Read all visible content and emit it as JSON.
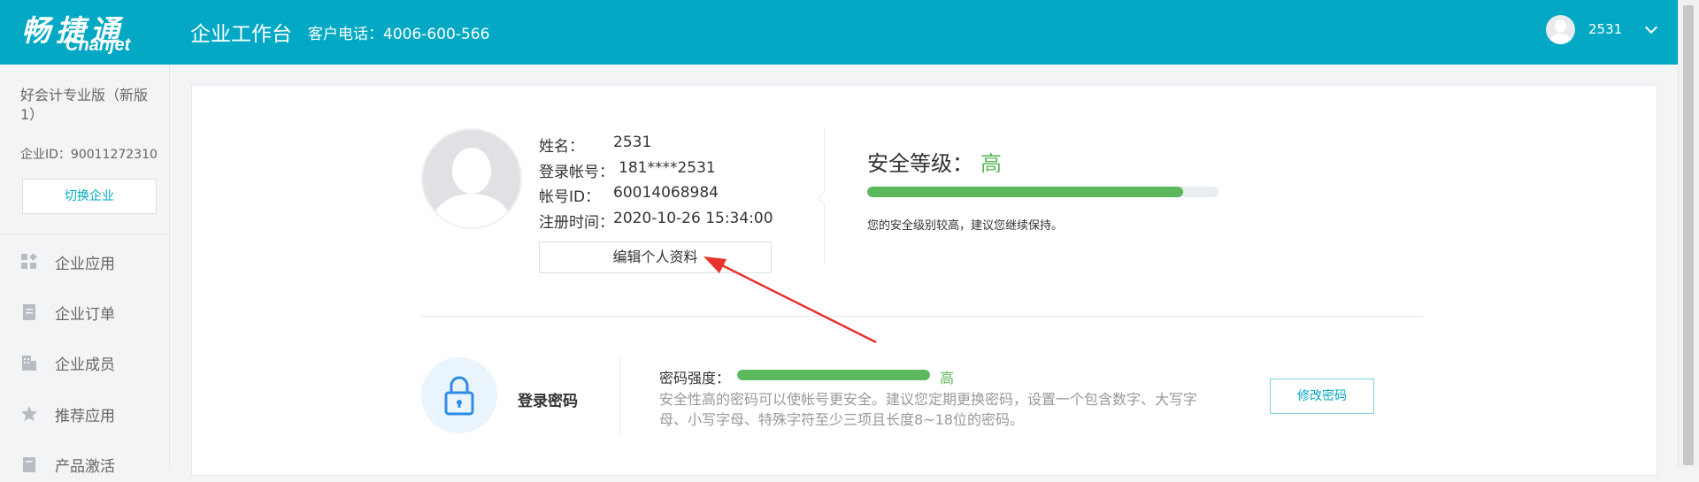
{
  "header": {
    "logo_cn": "畅捷通",
    "logo_en": "Chanjet",
    "app_title": "企业工作台",
    "phone": "客户电话：4006-600-566",
    "user_name": "2531",
    "user_menu_icon": "chevron-down-icon"
  },
  "sidebar": {
    "company_name": "好会计专业版（新版1）",
    "company_id": "企业ID：90011272310",
    "switch_label": "切换企业",
    "items": [
      {
        "label": "企业应用",
        "icon": "apps-icon"
      },
      {
        "label": "企业订单",
        "icon": "order-icon"
      },
      {
        "label": "企业成员",
        "icon": "building-icon"
      },
      {
        "label": "推荐应用",
        "icon": "star-icon"
      },
      {
        "label": "产品激活",
        "icon": "activate-icon"
      }
    ]
  },
  "profile": {
    "name_label": "姓名：",
    "name_value": "2531",
    "account_label": "登录帐号：",
    "account_value": "181****2531",
    "id_label": "帐号ID：",
    "id_value": "60014068984",
    "reg_label": "注册时间：",
    "reg_value": "2020-10-26 15:34:00",
    "edit_label": "编辑个人资料"
  },
  "security": {
    "title": "安全等级：",
    "level": "高",
    "level_fraction": 0.9,
    "tip": "您的安全级别较高，建议您继续保持。"
  },
  "password": {
    "label": "登录密码",
    "strength_label": "密码强度：",
    "strength_level": "高",
    "strength_fraction": 1.0,
    "desc_line1": "安全性高的密码可以使帐号更安全。建议您定期更换密码，设置一个包含数字、大写字",
    "desc_line2": "母、小写字母、特殊字符至少三项且长度8~18位的密码。",
    "change_label": "修改密码"
  },
  "colors": {
    "brand": "#03a9c4",
    "success": "#5cb85c",
    "annotation_arrow": "#e8322b"
  }
}
